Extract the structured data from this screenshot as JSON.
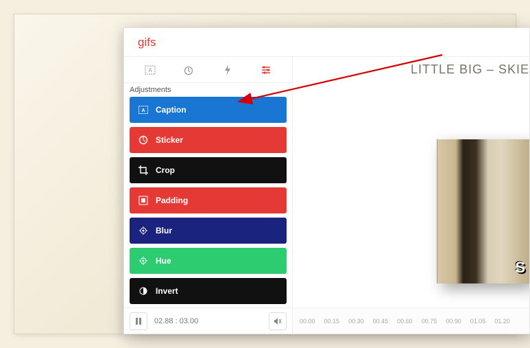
{
  "header": {
    "title": "gifs"
  },
  "panel": {
    "label": "Adjustments",
    "items": [
      {
        "label": "Caption",
        "color": "#1976d2",
        "icon": "caption"
      },
      {
        "label": "Sticker",
        "color": "#e53935",
        "icon": "sticker"
      },
      {
        "label": "Crop",
        "color": "#111111",
        "icon": "crop"
      },
      {
        "label": "Padding",
        "color": "#e53935",
        "icon": "padding"
      },
      {
        "label": "Blur",
        "color": "#1a237e",
        "icon": "blur"
      },
      {
        "label": "Hue",
        "color": "#2ecc71",
        "icon": "hue"
      },
      {
        "label": "Invert",
        "color": "#111111",
        "icon": "invert"
      }
    ]
  },
  "controls": {
    "time_current": "02.88",
    "time_total": "03.00",
    "time_sep": " : "
  },
  "preview": {
    "title": "LITTLE BIG – SKIE"
  },
  "timeline": {
    "ticks": [
      "00.00",
      "00.15",
      "00.30",
      "00.45",
      "00.60",
      "00.75",
      "00.90",
      "01.05",
      "01.20"
    ]
  }
}
